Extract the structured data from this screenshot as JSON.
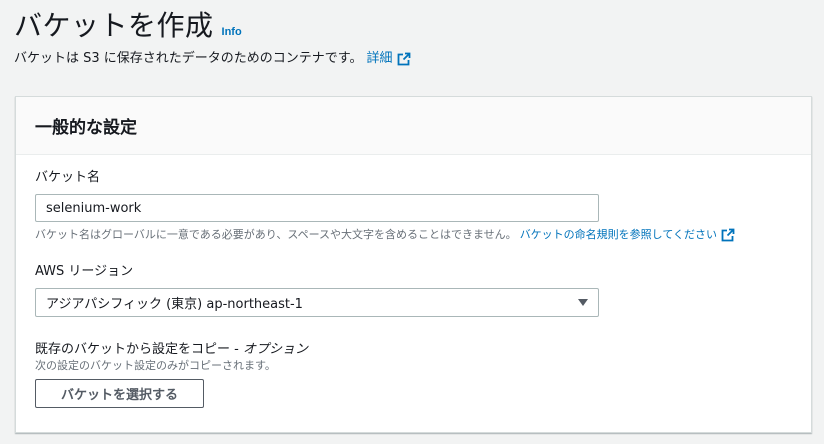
{
  "header": {
    "title": "バケットを作成",
    "info_label": "Info",
    "description": "バケットは S3 に保存されたデータのためのコンテナです。",
    "details_link": "詳細"
  },
  "general_settings": {
    "title": "一般的な設定",
    "bucket_name": {
      "label": "バケット名",
      "value": "selenium-work",
      "hint": "バケット名はグローバルに一意である必要があり、スペースや大文字を含めることはできません。",
      "hint_link": "バケットの命名規則を参照してください"
    },
    "region": {
      "label": "AWS リージョン",
      "selected": "アジアパシフィック (東京) ap-northeast-1"
    },
    "copy_settings": {
      "label": "既存のバケットから設定をコピー - ",
      "label_optional": "オプション",
      "hint": "次の設定のバケット設定のみがコピーされます。",
      "button": "バケットを選択する"
    }
  },
  "icons": {
    "external_link": "external-link-icon",
    "dropdown": "caret-down-icon"
  },
  "colors": {
    "link": "#0073bb",
    "background": "#f2f3f3",
    "panel_header": "#fafafa"
  }
}
